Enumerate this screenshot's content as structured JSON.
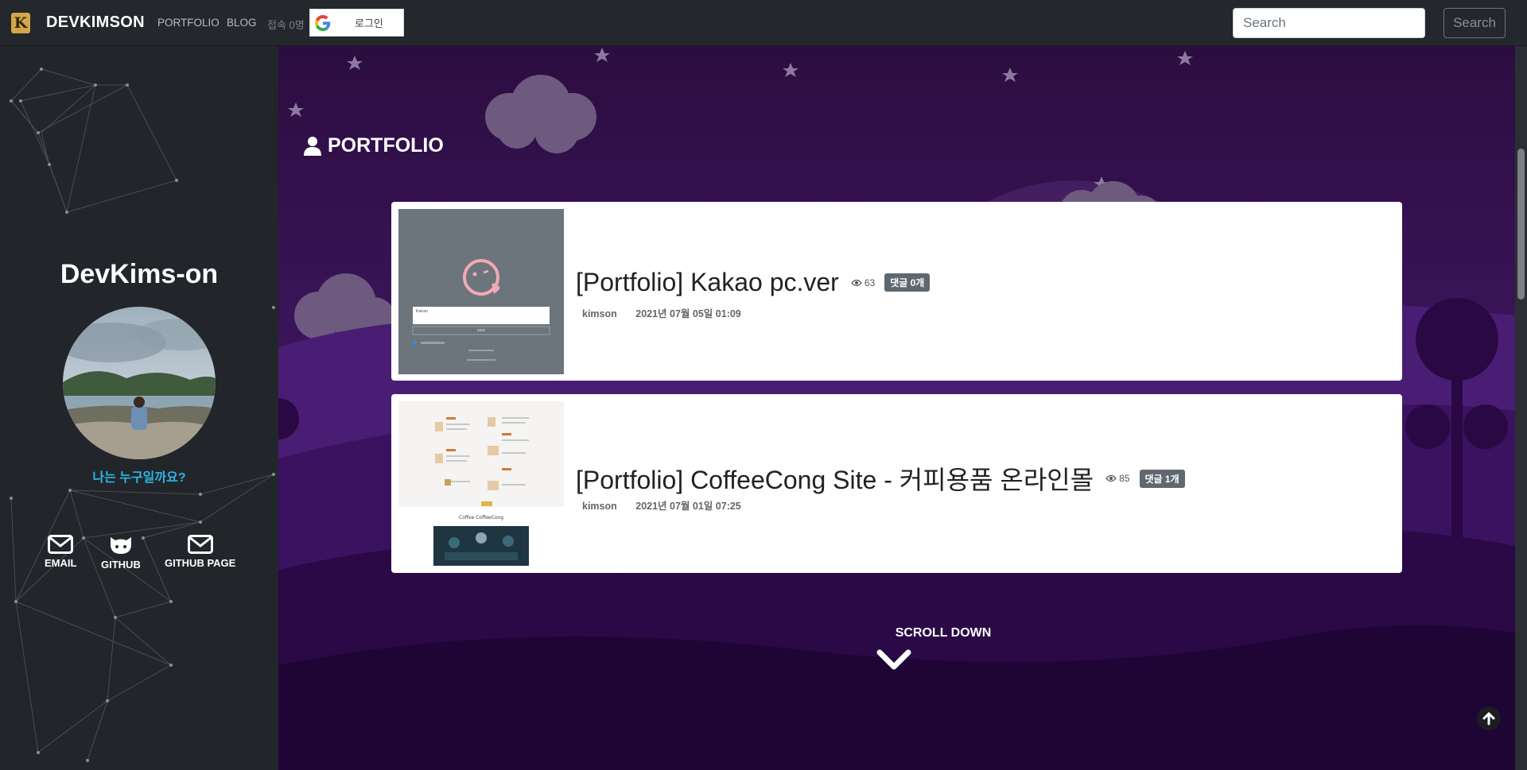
{
  "navbar": {
    "logo_letter": "K",
    "brand": "DEVKIMSON",
    "links": [
      "PORTFOLIO",
      "BLOG"
    ],
    "visitor": "접속 0명",
    "google_login_label": "로그인",
    "search_placeholder": "Search",
    "search_button": "Search"
  },
  "sidebar": {
    "name": "DevKims-on",
    "who_link": "나는 누구일까요?",
    "social": [
      {
        "label": "EMAIL",
        "icon": "envelope-icon"
      },
      {
        "label": "GITHUB",
        "icon": "github-icon"
      },
      {
        "label": "GITHUB PAGE",
        "icon": "envelope-icon"
      }
    ]
  },
  "main": {
    "section_title": "PORTFOLIO",
    "posts": [
      {
        "title": "[Portfolio] Kakao pc.ver",
        "views": "63",
        "comments": "댓글 0개",
        "author": "kimson",
        "date": "2021년 07월 05일 01:09"
      },
      {
        "title": "[Portfolio] CoffeeCong Site - 커피용품 온라인몰",
        "views": "85",
        "comments": "댓글 1개",
        "author": "kimson",
        "date": "2021년 07월 01일 07:25"
      }
    ],
    "scroll_down": "SCROLL DOWN"
  },
  "colors": {
    "navbar_bg": "#24272b",
    "sidebar_bg": "#22252a",
    "scene_purple": "#3b1358",
    "accent_link": "#2bb7e8",
    "badge_bg": "#5f676f"
  }
}
